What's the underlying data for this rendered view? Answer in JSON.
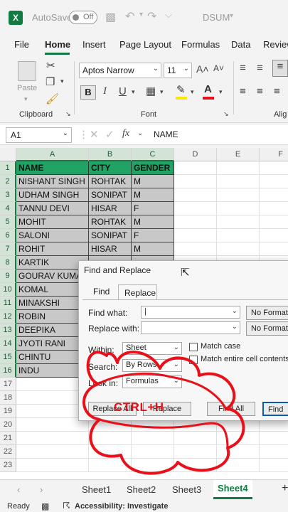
{
  "titlebar": {
    "autosave_label": "AutoSave",
    "toggle_state": "Off",
    "doc_title": "DSUM"
  },
  "menu": [
    "File",
    "Home",
    "Insert",
    "Page Layout",
    "Formulas",
    "Data",
    "Review"
  ],
  "ribbon": {
    "paste_label": "Paste",
    "clipboard_label": "Clipboard",
    "font_name": "Aptos Narrow",
    "font_size": "11",
    "font_label": "Font",
    "alignment_label": "Alig",
    "bold": "B",
    "italic": "I",
    "underline": "U",
    "grow": "A˄",
    "shrink": "A˅"
  },
  "formula": {
    "name_box": "A1",
    "fx": "fx",
    "content": "NAME"
  },
  "columns": [
    "A",
    "B",
    "C",
    "D",
    "E",
    "F"
  ],
  "rows": [
    "1",
    "2",
    "3",
    "4",
    "5",
    "6",
    "7",
    "8",
    "9",
    "10",
    "11",
    "12",
    "13",
    "14",
    "15",
    "16",
    "17",
    "18",
    "19",
    "20",
    "21",
    "22",
    "23"
  ],
  "table": {
    "headers": [
      "NAME",
      "CITY",
      "GENDER"
    ],
    "rows": [
      [
        "NISHANT SINGH",
        "ROHTAK",
        "M"
      ],
      [
        "UDHAM SINGH",
        "SONIPAT",
        "M"
      ],
      [
        "TANNU DEVI",
        "HISAR",
        "F"
      ],
      [
        "MOHIT",
        "ROHTAK",
        "M"
      ],
      [
        "SALONI",
        "SONIPAT",
        "F"
      ],
      [
        "ROHIT",
        "HISAR",
        "M"
      ],
      [
        "KARTIK",
        "",
        ""
      ],
      [
        "GOURAV KUMA",
        "",
        ""
      ],
      [
        "KOMAL",
        "",
        ""
      ],
      [
        "MINAKSHI",
        "",
        ""
      ],
      [
        "ROBIN",
        "",
        ""
      ],
      [
        "DEEPIKA",
        "",
        ""
      ],
      [
        "JYOTI RANI",
        "",
        ""
      ],
      [
        "CHINTU",
        "",
        ""
      ],
      [
        "INDU",
        "",
        ""
      ]
    ]
  },
  "dialog": {
    "title": "Find and Replace",
    "tab_find": "Find",
    "tab_replace": "Replace",
    "find_what_label": "Find what:",
    "replace_with_label": "Replace with:",
    "no_format_1": "No Format",
    "no_format_2": "No Format",
    "within_label": "Within:",
    "within_value": "Sheet",
    "search_label": "Search:",
    "search_value": "By Rows",
    "look_in_label": "Look in:",
    "look_in_value": "Formulas",
    "match_case": "Match case",
    "match_entire": "Match entire cell contents",
    "replace_all": "Replace All",
    "replace": "Replace",
    "find_all": "Find All",
    "find_next": "Find"
  },
  "annotation": {
    "text": "CTRL+H",
    "color": "#e8111a"
  },
  "sheets": [
    "Sheet1",
    "Sheet2",
    "Sheet3",
    "Sheet4"
  ],
  "active_sheet_index": 3,
  "status": {
    "ready": "Ready",
    "accessibility": "Accessibility: Investigate"
  },
  "colors": {
    "accent": "#107c41",
    "header_fill": "#21a366",
    "cell_fill": "#c8c8c8"
  }
}
